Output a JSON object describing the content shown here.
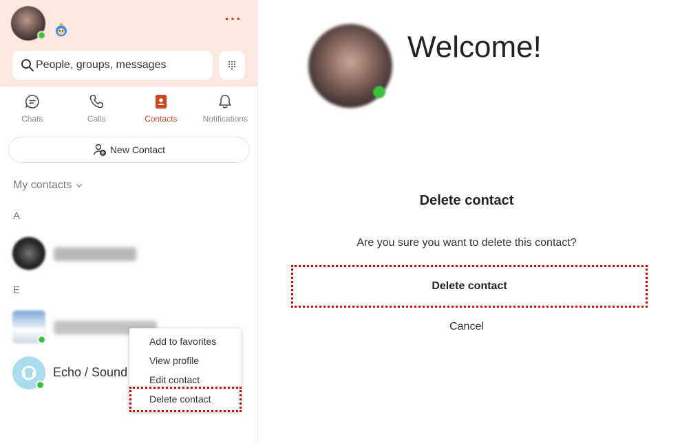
{
  "sidebar": {
    "search": {
      "placeholder": "People, groups, messages"
    },
    "tabs": [
      {
        "label": "Chats",
        "icon": "chat-icon"
      },
      {
        "label": "Calls",
        "icon": "phone-icon"
      },
      {
        "label": "Contacts",
        "icon": "contacts-book-icon",
        "active": true
      },
      {
        "label": "Notifications",
        "icon": "bell-icon"
      }
    ],
    "new_contact_label": "New Contact",
    "my_contacts_label": "My contacts",
    "groups": [
      {
        "letter": "A"
      },
      {
        "letter": "E"
      }
    ],
    "echo_contact_name": "Echo / Sound"
  },
  "context_menu": {
    "items": [
      "Add to favorites",
      "View profile",
      "Edit contact",
      "Delete contact"
    ]
  },
  "main": {
    "welcome": "Welcome!",
    "dialog": {
      "title": "Delete contact",
      "message": "Are you sure you want to delete this contact?",
      "confirm_label": "Delete contact",
      "cancel_label": "Cancel"
    }
  },
  "colors": {
    "accent": "#c8471f",
    "header_bg": "#fbe9e1",
    "presence_online": "#3cc13b",
    "highlight_frame": "#d40000"
  }
}
